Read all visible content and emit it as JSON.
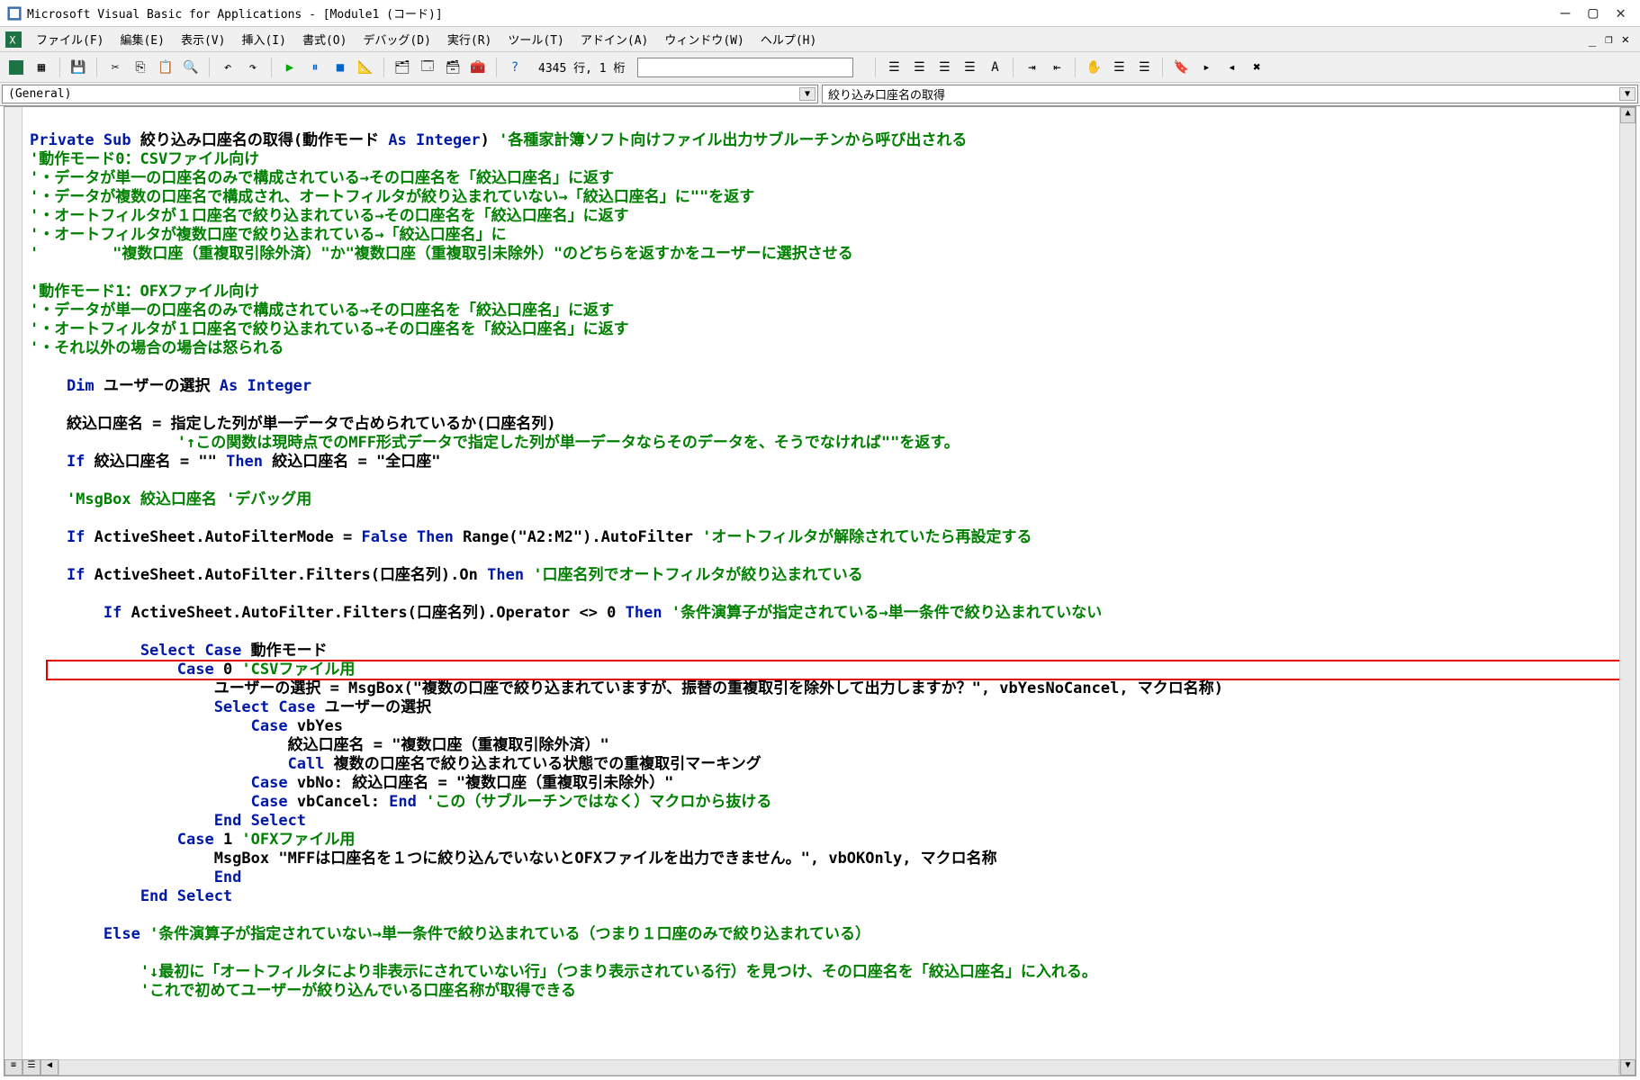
{
  "titlebar": {
    "text": "Microsoft Visual Basic for Applications - [Module1 (コード)]"
  },
  "menubar": {
    "file": "ファイル(F)",
    "edit": "編集(E)",
    "view": "表示(V)",
    "insert": "挿入(I)",
    "format": "書式(O)",
    "debug": "デバッグ(D)",
    "run": "実行(R)",
    "tools": "ツール(T)",
    "addins": "アドイン(A)",
    "window": "ウィンドウ(W)",
    "help": "ヘルプ(H)"
  },
  "toolbar": {
    "status": "4345 行, 1 桁"
  },
  "dropdowns": {
    "left": "(General)",
    "right": "絞り込み口座名の取得"
  },
  "code": {
    "l01_a": "Private Sub",
    "l01_b": " 絞り込み口座名の取得(動作モード ",
    "l01_c": "As Integer",
    "l01_d": ") ",
    "l01_e": "'各種家計簿ソフト向けファイル出力サブルーチンから呼び出される",
    "l02": "'動作モード0：CSVファイル向け",
    "l03": "'・データが単一の口座名のみで構成されている→その口座名を「絞込口座名」に返す",
    "l04": "'・データが複数の口座名で構成され、オートフィルタが絞り込まれていない→「絞込口座名」に\"\"を返す",
    "l05": "'・オートフィルタが１口座名で絞り込まれている→その口座名を「絞込口座名」に返す",
    "l06": "'・オートフィルタが複数口座で絞り込まれている→「絞込口座名」に",
    "l07": "'        \"複数口座（重複取引除外済）\"か\"複数口座（重複取引未除外）\"のどちらを返すかをユーザーに選択させる",
    "l08": "",
    "l09": "'動作モード1：OFXファイル向け",
    "l10": "'・データが単一の口座名のみで構成されている→その口座名を「絞込口座名」に返す",
    "l11": "'・オートフィルタが１口座名で絞り込まれている→その口座名を「絞込口座名」に返す",
    "l12": "'・それ以外の場合の場合は怒られる",
    "l13": "",
    "l14_a": "    Dim",
    "l14_b": " ユーザーの選択 ",
    "l14_c": "As Integer",
    "l15": "",
    "l16": "    絞込口座名 = 指定した列が単一データで占められているか(口座名列)",
    "l17": "                '↑この関数は現時点でのMFF形式データで指定した列が単一データならそのデータを、そうでなければ\"\"を返す。",
    "l18_a": "    If",
    "l18_b": " 絞込口座名 = \"\" ",
    "l18_c": "Then",
    "l18_d": " 絞込口座名 = \"全口座\"",
    "l19": "",
    "l20": "    'MsgBox 絞込口座名 'デバッグ用",
    "l21": "",
    "l22_a": "    If",
    "l22_b": " ActiveSheet.AutoFilterMode = ",
    "l22_c": "False Then",
    "l22_d": " Range(\"A2:M2\").AutoFilter ",
    "l22_e": "'オートフィルタが解除されていたら再設定する",
    "l23": "",
    "l24_a": "    If",
    "l24_b": " ActiveSheet.AutoFilter.Filters(口座名列).On ",
    "l24_c": "Then ",
    "l24_d": "'口座名列でオートフィルタが絞り込まれている",
    "l25": "",
    "l26_a": "        If",
    "l26_b": " ActiveSheet.AutoFilter.Filters(口座名列).Operator <> 0 ",
    "l26_c": "Then ",
    "l26_d": "'条件演算子が指定されている→単一条件で絞り込まれていない",
    "l27": "",
    "l28_a": "            Select Case",
    "l28_b": " 動作モード",
    "l29_a": "                Case",
    "l29_b": " 0 ",
    "l29_c": "'CSVファイル用",
    "l30": "                    ユーザーの選択 = MsgBox(\"複数の口座で絞り込まれていますが、振替の重複取引を除外して出力しますか？\", vbYesNoCancel, マクロ名称)",
    "l31_a": "                    Select Case",
    "l31_b": " ユーザーの選択",
    "l32_a": "                        Case",
    "l32_b": " vbYes",
    "l33": "                            絞込口座名 = \"複数口座（重複取引除外済）\"",
    "l34_a": "                            Call",
    "l34_b": " 複数の口座名で絞り込まれている状態での重複取引マーキング",
    "l35_a": "                        Case",
    "l35_b": " vbNo: 絞込口座名 = \"複数口座（重複取引未除外）\"",
    "l36_a": "                        Case",
    "l36_b": " vbCancel: ",
    "l36_c": "End ",
    "l36_d": "'この（サブルーチンではなく）マクロから抜ける",
    "l37": "                    End Select",
    "l38_a": "                Case",
    "l38_b": " 1 ",
    "l38_c": "'OFXファイル用",
    "l39": "                    MsgBox \"MFFは口座名を１つに絞り込んでいないとOFXファイルを出力できません。\", vbOKOnly, マクロ名称",
    "l40": "                    End",
    "l41": "            End Select",
    "l42": "",
    "l43_a": "        Else ",
    "l43_b": "'条件演算子が指定されていない→単一条件で絞り込まれている（つまり１口座のみで絞り込まれている）",
    "l44": "",
    "l45": "            '↓最初に「オートフィルタにより非表示にされていない行」（つまり表示されている行）を見つけ、その口座名を「絞込口座名」に入れる。",
    "l46": "            'これで初めてユーザーが絞り込んでいる口座名称が取得できる"
  }
}
